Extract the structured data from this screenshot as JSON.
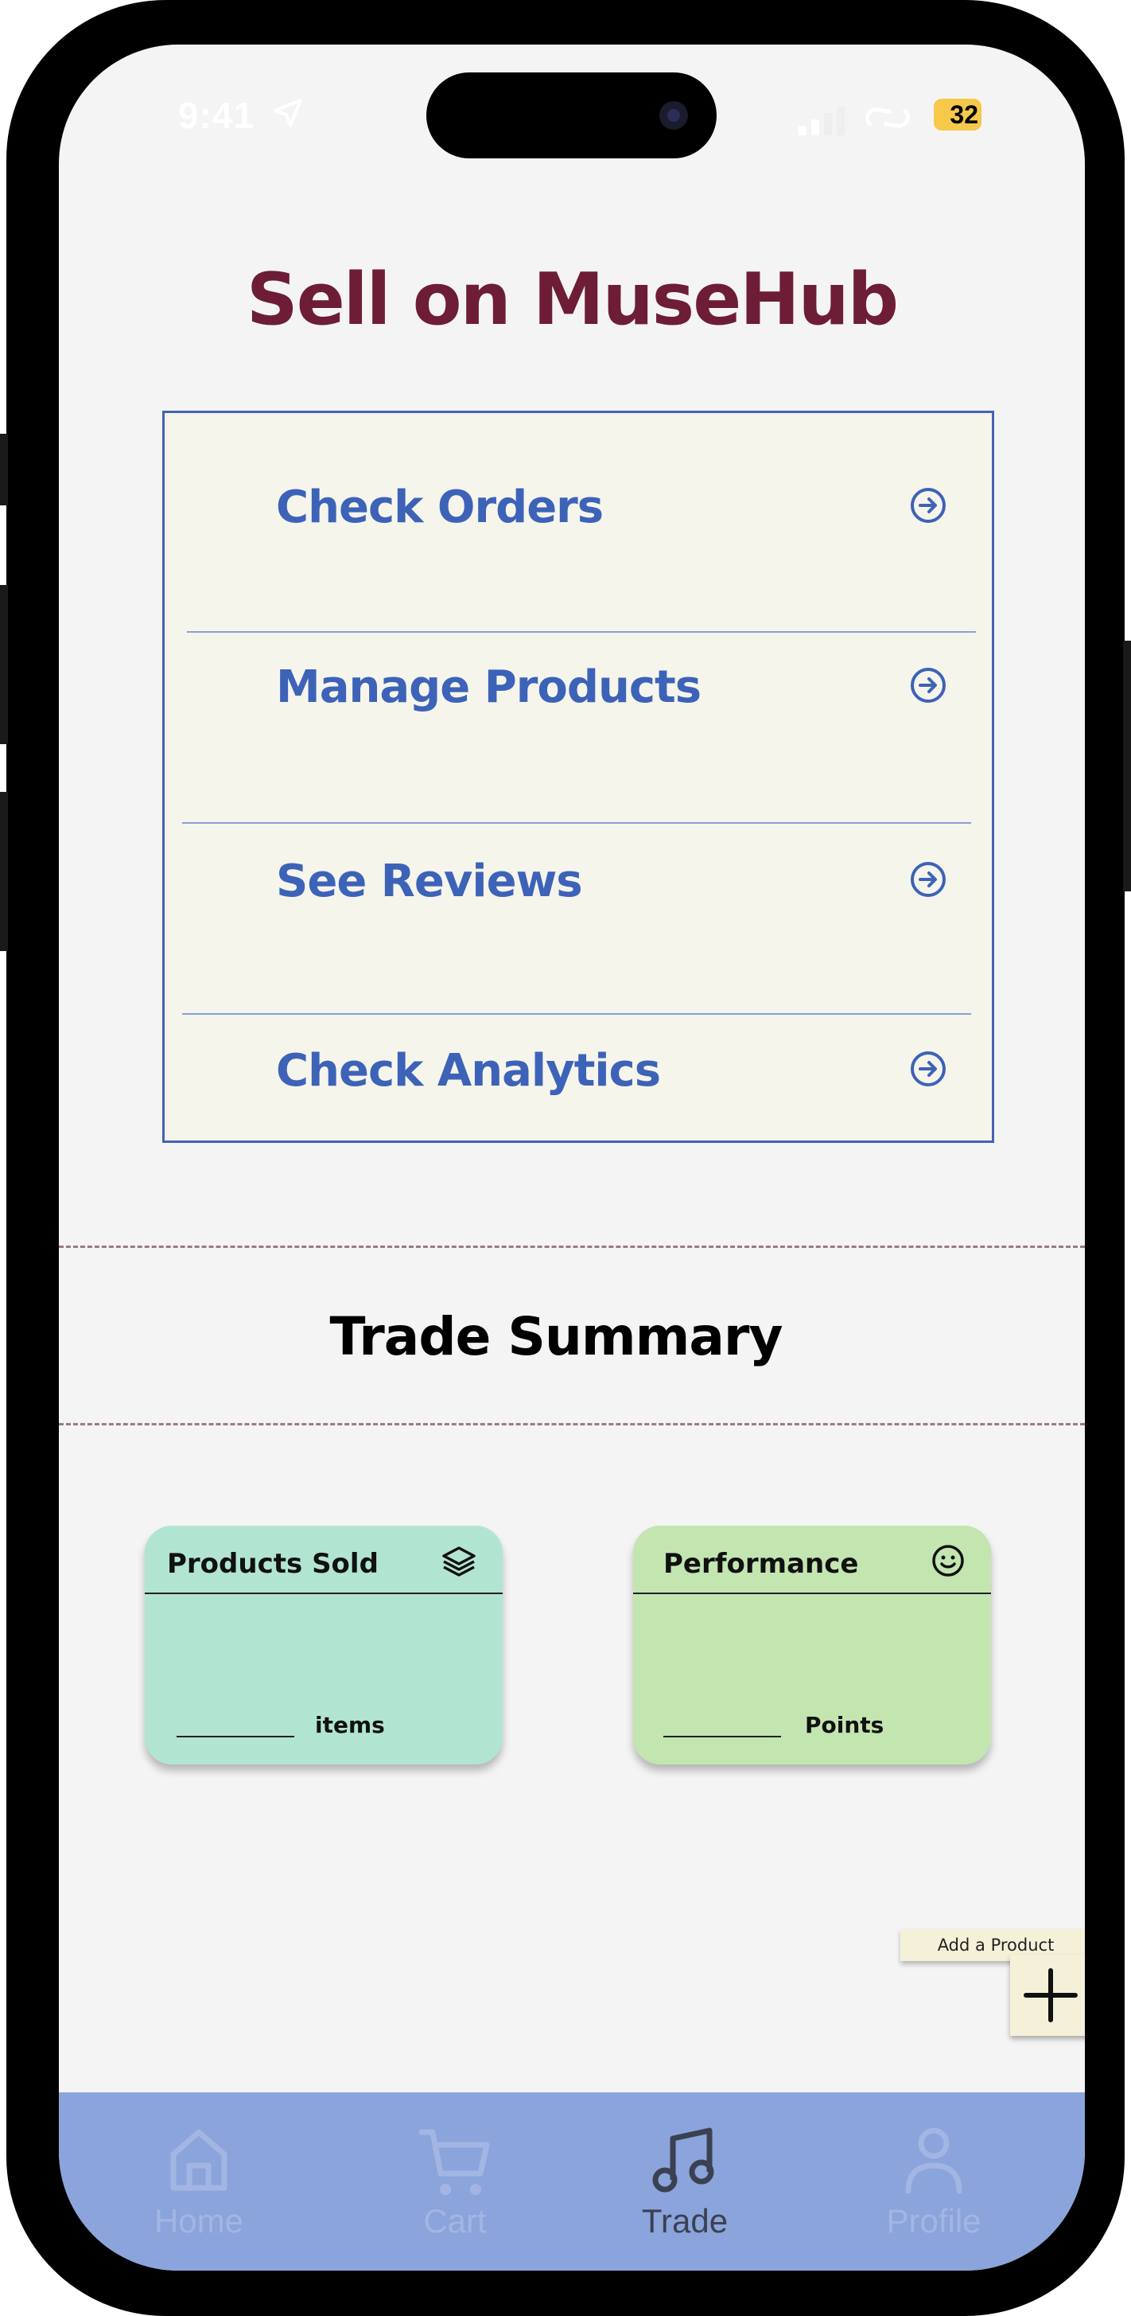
{
  "status_bar": {
    "time": "9:41",
    "battery": "32"
  },
  "page": {
    "title": "Sell on MuseHub"
  },
  "menu": {
    "items": [
      {
        "label": "Check Orders"
      },
      {
        "label": "Manage Products"
      },
      {
        "label": "See Reviews"
      },
      {
        "label": "Check Analytics"
      }
    ]
  },
  "trade_summary": {
    "title": "Trade Summary",
    "cards": [
      {
        "title": "Products Sold",
        "unit": "items",
        "icon": "layers-icon",
        "color": "#b1e5d2"
      },
      {
        "title": "Performance",
        "unit": "Points",
        "icon": "smiley-icon",
        "color": "#c3e5b0"
      }
    ]
  },
  "add_product": {
    "label": "Add a Product"
  },
  "tabbar": {
    "items": [
      {
        "label": "Home",
        "icon": "home-icon",
        "active": false
      },
      {
        "label": "Cart",
        "icon": "cart-icon",
        "active": false
      },
      {
        "label": "Trade",
        "icon": "music-note-icon",
        "active": true
      },
      {
        "label": "Profile",
        "icon": "person-icon",
        "active": false
      }
    ]
  },
  "colors": {
    "title": "#6e1d37",
    "accent": "#3d63b8",
    "tabbar": "#8ba4db",
    "menu_bg": "#f6f5ec"
  }
}
